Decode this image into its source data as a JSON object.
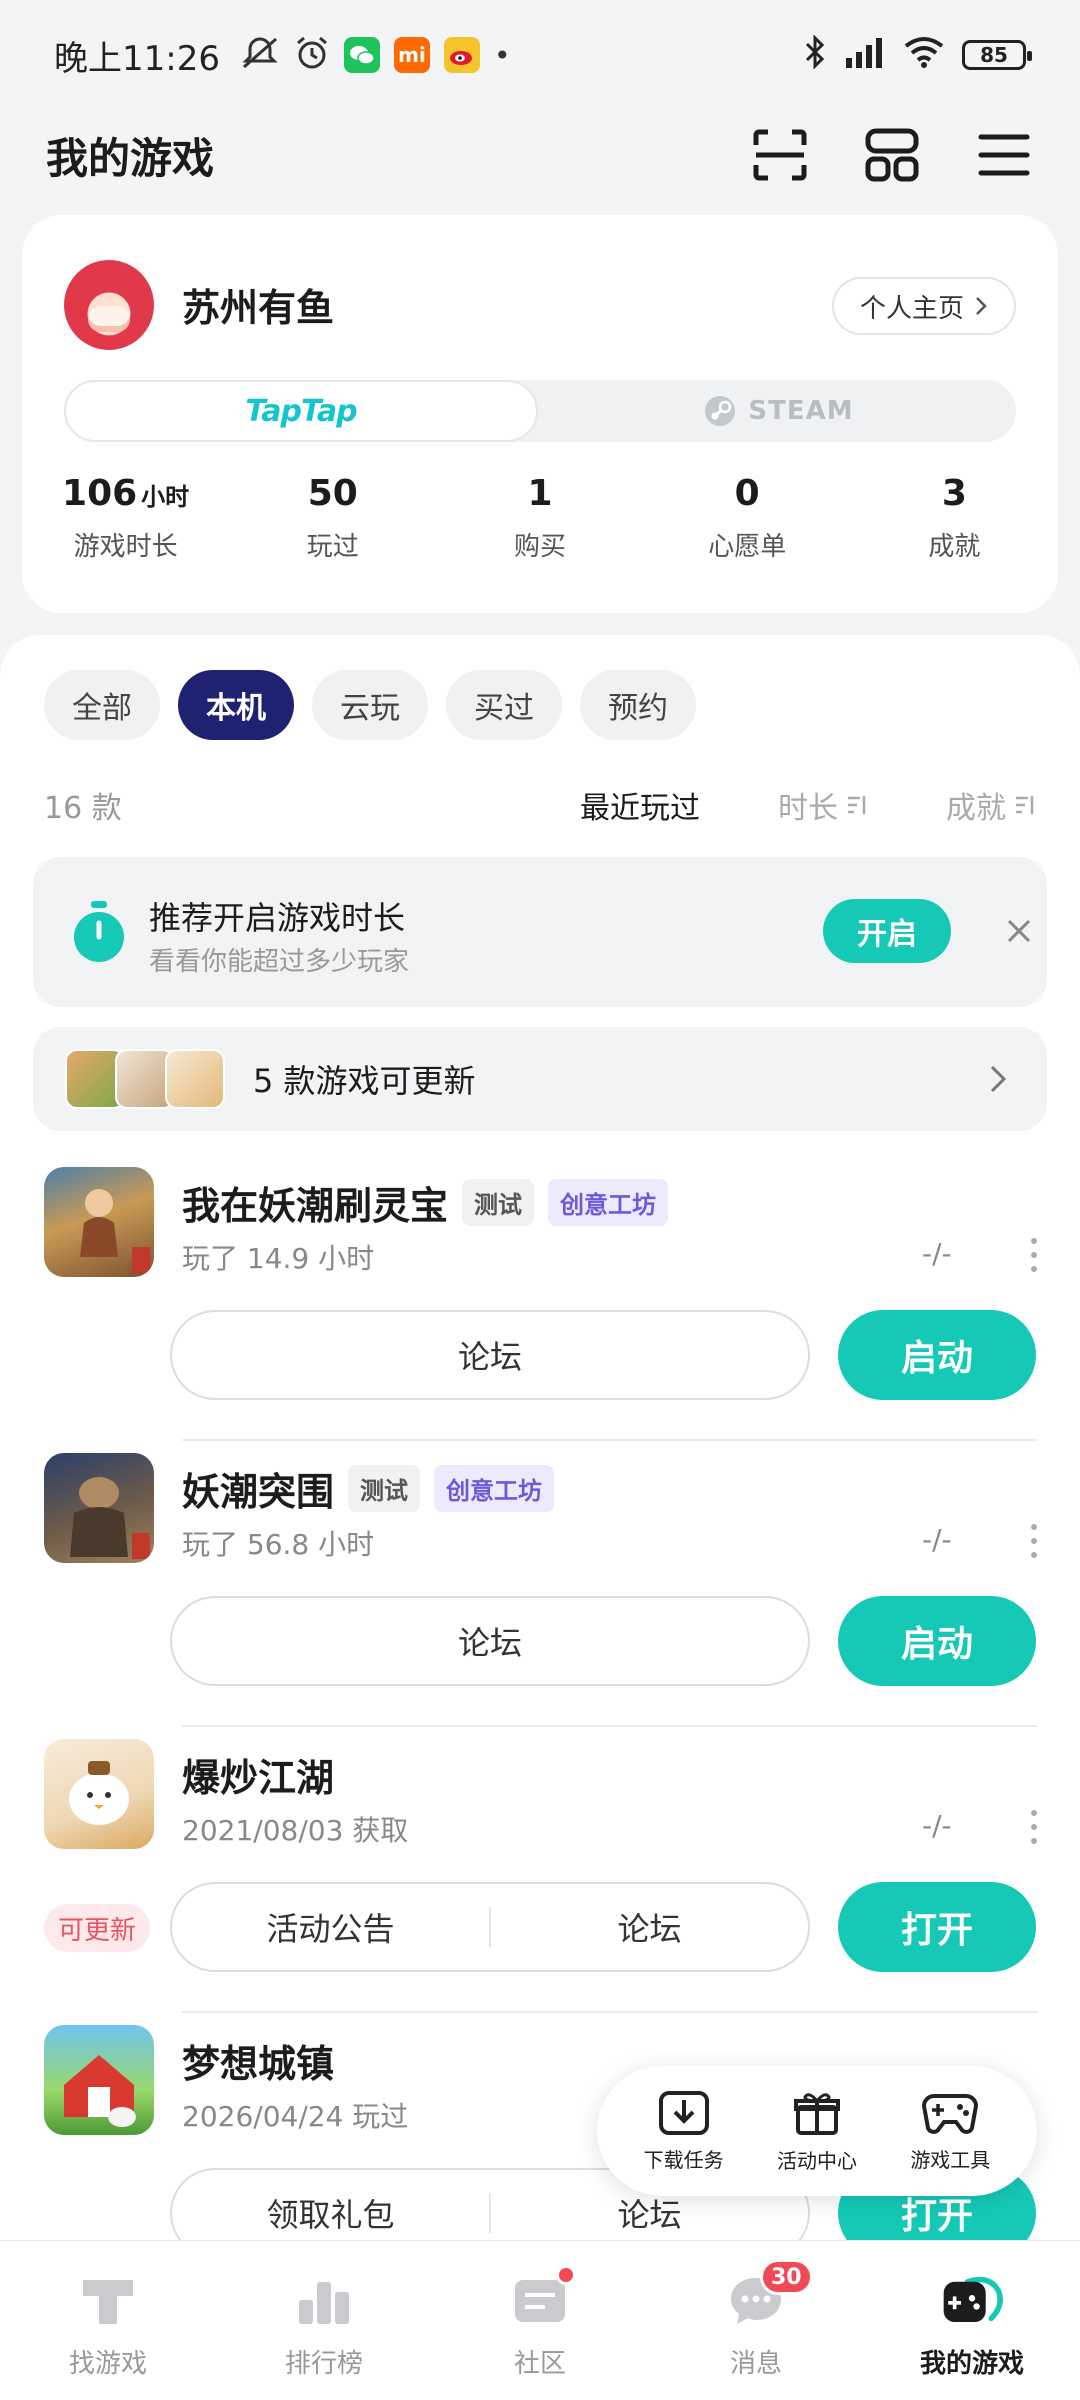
{
  "status_bar": {
    "time": "晚上11:26",
    "battery": "85"
  },
  "header": {
    "title": "我的游戏"
  },
  "profile": {
    "username": "苏州有鱼",
    "profile_link": "个人主页",
    "platforms": [
      "TapTap",
      "STEAM"
    ],
    "active_platform": "TapTap",
    "stats": [
      {
        "value": "106",
        "unit": "小时",
        "label": "游戏时长"
      },
      {
        "value": "50",
        "unit": "",
        "label": "玩过"
      },
      {
        "value": "1",
        "unit": "",
        "label": "购买"
      },
      {
        "value": "0",
        "unit": "",
        "label": "心愿单"
      },
      {
        "value": "3",
        "unit": "",
        "label": "成就"
      }
    ]
  },
  "filters": [
    "全部",
    "本机",
    "云玩",
    "买过",
    "预约"
  ],
  "active_filter": "本机",
  "list_meta": {
    "count": "16 款",
    "sorts": [
      "最近玩过",
      "时长",
      "成就"
    ],
    "active_sort": "最近玩过"
  },
  "tip": {
    "title": "推荐开启游戏时长",
    "subtitle": "看看你能超过多少玩家",
    "button": "开启"
  },
  "updates": {
    "text": "5 款游戏可更新"
  },
  "games": [
    {
      "name": "我在妖潮刷灵宝",
      "tags": [
        "测试",
        "创意工坊"
      ],
      "subtitle": "玩了 14.9 小时",
      "rating": "-/-",
      "actions": [
        "论坛"
      ],
      "button": "启动",
      "update_badge": ""
    },
    {
      "name": "妖潮突围",
      "tags": [
        "测试",
        "创意工坊"
      ],
      "subtitle": "玩了 56.8 小时",
      "rating": "-/-",
      "actions": [
        "论坛"
      ],
      "button": "启动",
      "update_badge": ""
    },
    {
      "name": "爆炒江湖",
      "tags": [],
      "subtitle": "2021/08/03 获取",
      "rating": "-/-",
      "actions": [
        "活动公告",
        "论坛"
      ],
      "button": "打开",
      "update_badge": "可更新"
    },
    {
      "name": "梦想城镇",
      "tags": [],
      "subtitle": "2026/04/24 玩过",
      "rating": "",
      "actions": [
        "领取礼包",
        "论坛"
      ],
      "button": "打开",
      "update_badge": ""
    }
  ],
  "quick_tools": [
    "下载任务",
    "活动中心",
    "游戏工具"
  ],
  "bottom_nav": [
    {
      "label": "找游戏",
      "icon": "taptap-logo-icon",
      "badge": ""
    },
    {
      "label": "排行榜",
      "icon": "ranking-icon",
      "badge": ""
    },
    {
      "label": "社区",
      "icon": "community-icon",
      "badge": "dot"
    },
    {
      "label": "消息",
      "icon": "message-icon",
      "badge": "30"
    },
    {
      "label": "我的游戏",
      "icon": "gamepad-icon",
      "badge": ""
    }
  ],
  "colors": {
    "accent": "#15c9b6",
    "active_chip": "#1f2270",
    "workshop_tag": "#6f59d9",
    "badge_red": "#ef4a55"
  }
}
